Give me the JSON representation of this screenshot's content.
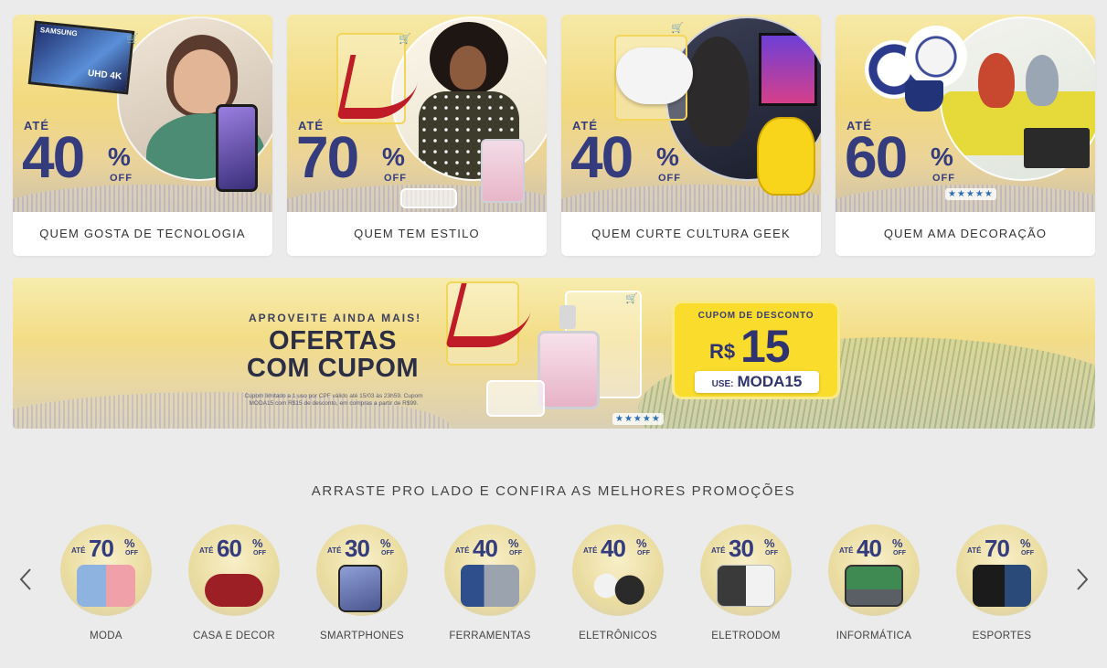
{
  "cards": [
    {
      "ate": "ATÉ",
      "number": "40",
      "percent": "%",
      "off": "OFF",
      "label": "QUEM GOSTA DE TECNOLOGIA",
      "tv_brand": "SAMSUNG",
      "tv_badge": "UHD 4K"
    },
    {
      "ate": "ATÉ",
      "number": "70",
      "percent": "%",
      "off": "OFF",
      "label": "QUEM TEM ESTILO"
    },
    {
      "ate": "ATÉ",
      "number": "40",
      "percent": "%",
      "off": "OFF",
      "label": "QUEM CURTE CULTURA GEEK"
    },
    {
      "ate": "ATÉ",
      "number": "60",
      "percent": "%",
      "off": "OFF",
      "label": "QUEM AMA DECORAÇÃO",
      "stars": "★★★★★"
    }
  ],
  "banner": {
    "subtitle": "APROVEITE AINDA MAIS!",
    "title_line1": "OFERTAS",
    "title_line2": "COM CUPOM",
    "fine_print": "Cupom limitado a 1 uso por CPF válido até 15/03 às 23h59. Cupom MODA15 com R$15 de desconto, em compras a partir de R$99.",
    "stars": "★★★★★",
    "coupon": {
      "heading": "CUPOM DE DESCONTO",
      "currency": "R$",
      "value": "15",
      "use_label": "USE:",
      "code": "MODA15"
    }
  },
  "carousel": {
    "title": "ARRASTE PRO LADO E CONFIRA AS MELHORES PROMOÇÕES",
    "prev_icon": "chevron-left-icon",
    "next_icon": "chevron-right-icon",
    "items": [
      {
        "ate": "ATÉ",
        "number": "70",
        "percent": "%",
        "off": "OFF",
        "label": "MODA",
        "color": "#8fb3e0"
      },
      {
        "ate": "ATÉ",
        "number": "60",
        "percent": "%",
        "off": "OFF",
        "label": "CASA E DECOR",
        "color": "#9c1f26"
      },
      {
        "ate": "ATÉ",
        "number": "30",
        "percent": "%",
        "off": "OFF",
        "label": "SMARTPHONES",
        "color": "#6f7db8"
      },
      {
        "ate": "ATÉ",
        "number": "40",
        "percent": "%",
        "off": "OFF",
        "label": "FERRAMENTAS",
        "color": "#2f4e8c"
      },
      {
        "ate": "ATÉ",
        "number": "40",
        "percent": "%",
        "off": "OFF",
        "label": "ELETRÔNICOS",
        "color": "#3a3a3a"
      },
      {
        "ate": "ATÉ",
        "number": "30",
        "percent": "%",
        "off": "OFF",
        "label": "ELETRODOM",
        "color": "#cfd3d8"
      },
      {
        "ate": "ATÉ",
        "number": "40",
        "percent": "%",
        "off": "OFF",
        "label": "INFORMÁTICA",
        "color": "#4a4f57"
      },
      {
        "ate": "ATÉ",
        "number": "70",
        "percent": "%",
        "off": "OFF",
        "label": "ESPORTES",
        "color": "#1b1b1b"
      }
    ]
  }
}
